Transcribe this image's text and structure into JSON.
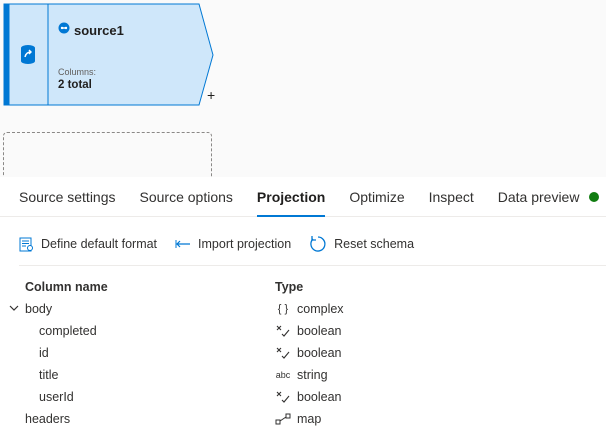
{
  "node": {
    "title": "source1",
    "columns_label": "Columns:",
    "columns_total": "2 total",
    "add_symbol": "+"
  },
  "tabs": [
    {
      "label": "Source settings"
    },
    {
      "label": "Source options"
    },
    {
      "label": "Projection",
      "active": true
    },
    {
      "label": "Optimize"
    },
    {
      "label": "Inspect"
    },
    {
      "label": "Data preview"
    }
  ],
  "status_color": "#107c10",
  "toolbar": {
    "define_default_format": "Define default format",
    "import_projection": "Import projection",
    "reset_schema": "Reset schema"
  },
  "table": {
    "headers": {
      "column_name": "Column name",
      "type": "Type"
    },
    "rows": [
      {
        "name": "body",
        "type": "complex",
        "icon": "braces-icon",
        "type_glyph": "{ }",
        "expanded": true
      },
      {
        "name": "completed",
        "type": "boolean",
        "icon": "boolean-icon",
        "child": true
      },
      {
        "name": "id",
        "type": "boolean",
        "icon": "boolean-icon",
        "child": true
      },
      {
        "name": "title",
        "type": "string",
        "icon": "string-icon",
        "type_glyph": "abc",
        "child": true
      },
      {
        "name": "userId",
        "type": "boolean",
        "icon": "boolean-icon",
        "child": true
      },
      {
        "name": "headers",
        "type": "map",
        "icon": "map-icon"
      }
    ]
  },
  "accent": "#0078d4"
}
